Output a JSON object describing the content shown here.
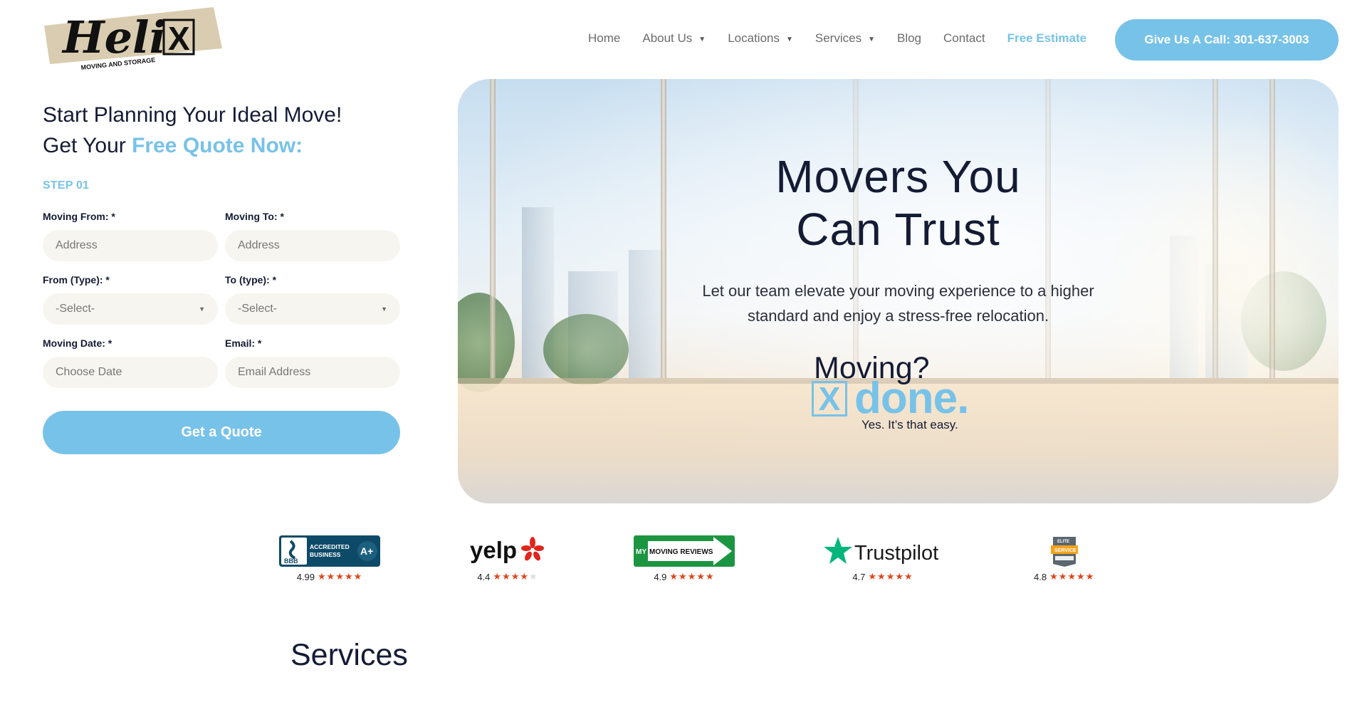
{
  "header": {
    "logo": {
      "brand": "Heli",
      "brand_mark": "X",
      "sub": "MOVING AND STORAGE"
    },
    "nav": [
      {
        "label": "Home",
        "has_dropdown": false
      },
      {
        "label": "About Us",
        "has_dropdown": true
      },
      {
        "label": "Locations",
        "has_dropdown": true
      },
      {
        "label": "Services",
        "has_dropdown": true
      },
      {
        "label": "Blog",
        "has_dropdown": false
      },
      {
        "label": "Contact",
        "has_dropdown": false
      }
    ],
    "free_estimate": "Free Estimate",
    "call_button": "Give Us A Call: 301-637-3003",
    "caret": "▼"
  },
  "form": {
    "heading_line1": "Start Planning Your Ideal Move!",
    "heading_line2_prefix": "Get Your ",
    "heading_line2_accent": "Free Quote Now:",
    "step": "STEP 01",
    "fields": {
      "moving_from": {
        "label": "Moving From: *",
        "placeholder": "Address"
      },
      "moving_to": {
        "label": "Moving To: *",
        "placeholder": "Address"
      },
      "from_type": {
        "label": "From (Type): *",
        "value": "-Select-"
      },
      "to_type": {
        "label": "To (type): *",
        "value": "-Select-"
      },
      "moving_date": {
        "label": "Moving Date: *",
        "placeholder": "Choose Date"
      },
      "email": {
        "label": "Email: *",
        "placeholder": "Email Address"
      }
    },
    "submit": "Get a Quote"
  },
  "hero": {
    "title_line1": "Movers You",
    "title_line2": "Can Trust",
    "subtitle_line1": "Let our team elevate your moving experience to a higher",
    "subtitle_line2": "standard and enjoy a stress-free relocation.",
    "tagline": {
      "moving": "Moving?",
      "mark": "X",
      "done": "done.",
      "easy": "Yes. It’s that easy."
    }
  },
  "reviews": [
    {
      "name": "BBB Accredited Business",
      "text1": "ACCREDITED",
      "text2": "BUSINESS",
      "grade": "A+",
      "short": "BBB",
      "rating": "4.99",
      "stars": 5
    },
    {
      "name": "Yelp",
      "text1": "yelp",
      "rating": "4.4",
      "stars": 4
    },
    {
      "name": "My Moving Reviews",
      "text1": "MY",
      "text2": "MOVING REVIEWS",
      "rating": "4.9",
      "stars": 5
    },
    {
      "name": "Trustpilot",
      "text1": "Trustpilot",
      "rating": "4.7",
      "stars": 5
    },
    {
      "name": "HomeAdvisor Elite Service",
      "text1": "ELITE",
      "text2": "SERVICE",
      "rating": "4.8",
      "stars": 5
    }
  ],
  "services": {
    "title": "Services"
  },
  "colors": {
    "accent": "#77c2e8",
    "navy": "#141b34",
    "input_bg": "#f7f5ef",
    "star": "#e0461c"
  }
}
